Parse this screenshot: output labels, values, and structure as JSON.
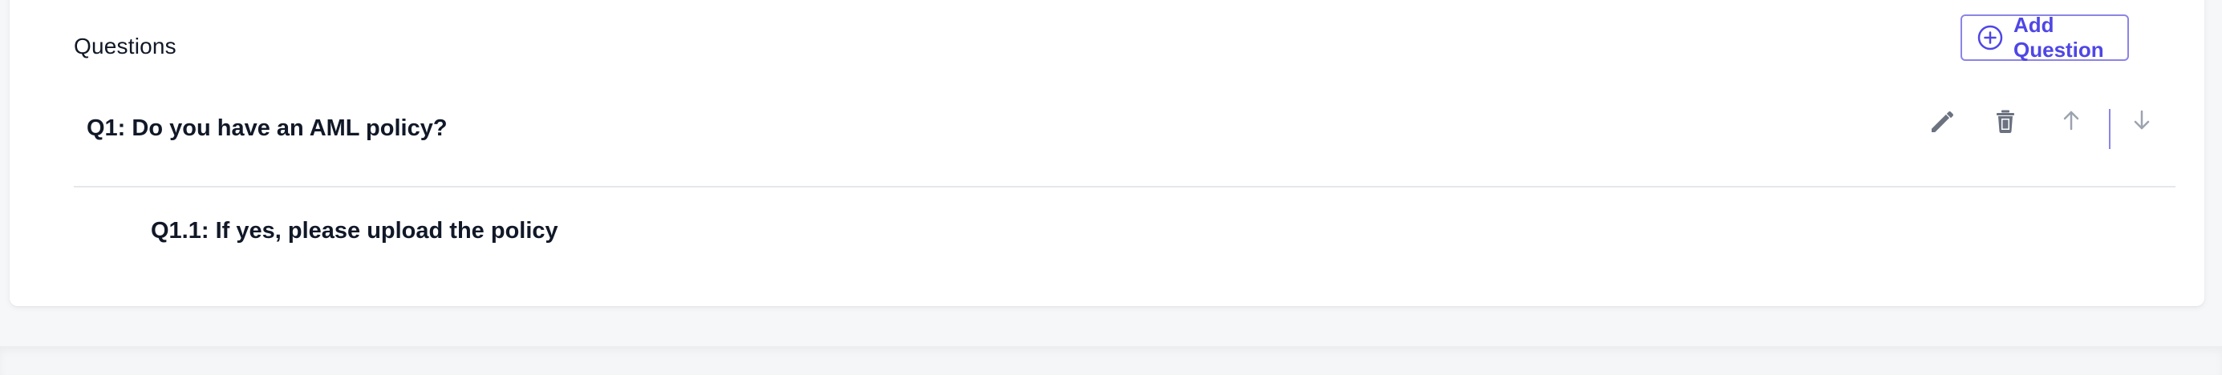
{
  "questions_section": {
    "title": "Questions",
    "add_button_label": "Add Question",
    "items": [
      {
        "label": "Q1: Do you have an AML policy?",
        "actions": [
          "pencil-icon",
          "trash-icon",
          "arrow-up-icon",
          "arrow-down-icon"
        ],
        "subquestions": [
          {
            "label": "Q1.1: If yes, please upload the policy"
          }
        ]
      }
    ]
  },
  "colors": {
    "accent": "#4f46e5",
    "accent_border": "#8b84e8",
    "text": "#111827",
    "icon_dark": "#6b7280",
    "icon_light": "#9ca3af",
    "divider": "#e5e7eb"
  }
}
